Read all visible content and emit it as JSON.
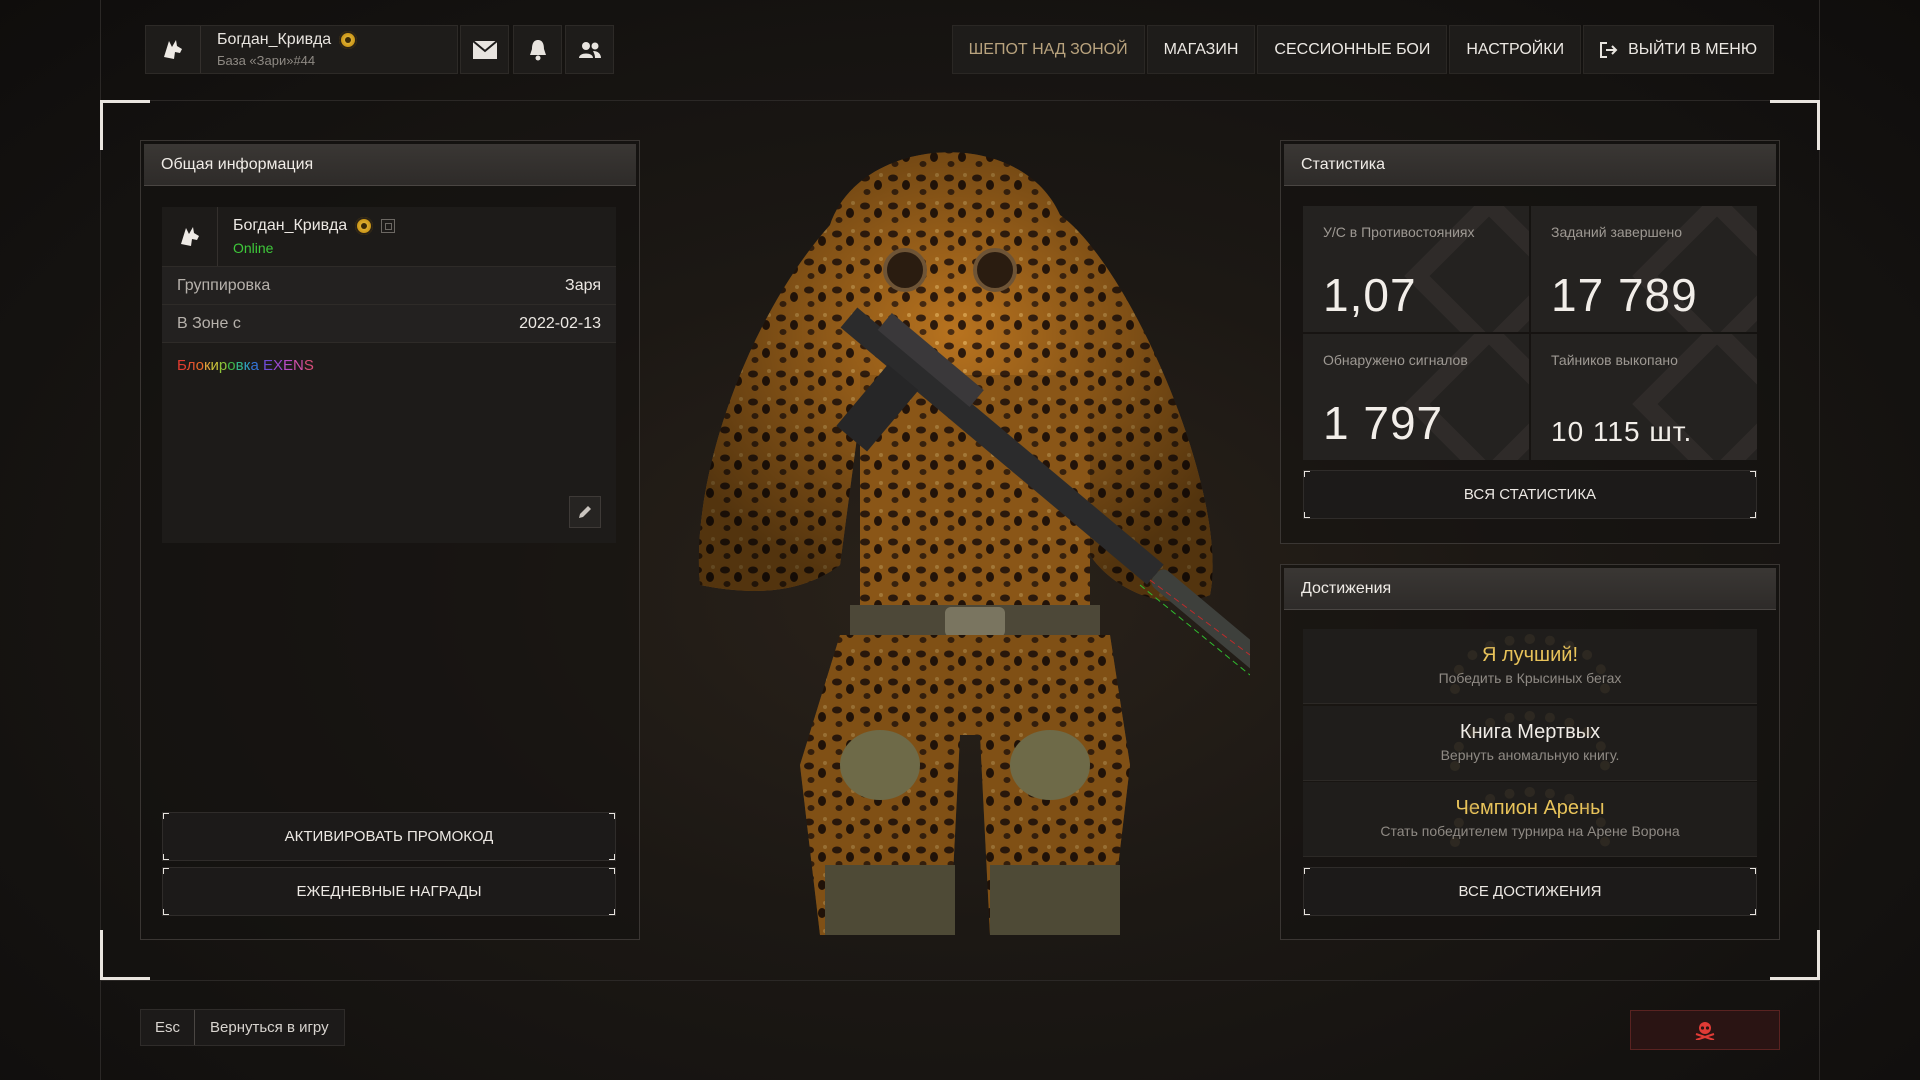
{
  "header": {
    "username": "Богдан_Кривда",
    "base": "База «Зари»#44",
    "nav": [
      {
        "label": "ШЕПОТ НАД ЗОНОЙ",
        "active": true
      },
      {
        "label": "МАГАЗИН"
      },
      {
        "label": "СЕССИОННЫЕ БОИ"
      },
      {
        "label": "НАСТРОЙКИ"
      },
      {
        "label": "ВЫЙТИ В МЕНЮ",
        "icon": "exit-icon"
      }
    ]
  },
  "general": {
    "title": "Общая информация",
    "username": "Богдан_Кривда",
    "status": "Online",
    "rows": [
      {
        "key": "Группировка",
        "value": "Заря"
      },
      {
        "key": "В Зоне с",
        "value": "2022-02-13"
      }
    ],
    "bio": "Блокировка EXENS",
    "promo_label": "АКТИВИРОВАТЬ ПРОМОКОД",
    "daily_label": "ЕЖЕДНЕВНЫЕ НАГРАДЫ"
  },
  "stats": {
    "title": "Статистика",
    "cells": [
      {
        "label": "У/С в Противостояниях",
        "value": "1,07"
      },
      {
        "label": "Заданий завершено",
        "value": "17 789"
      },
      {
        "label": "Обнаружено сигналов",
        "value": "1 797"
      },
      {
        "label": "Тайников выкопано",
        "value": "10 115 шт."
      }
    ],
    "all_label": "ВСЯ СТАТИСТИКА"
  },
  "achievements": {
    "title": "Достижения",
    "items": [
      {
        "title": "Я лучший!",
        "desc": "Победить в Крысиных бегах",
        "color": "#e8c35a"
      },
      {
        "title": "Книга Мертвых",
        "desc": "Вернуть аномальную книгу.",
        "color": "#f0ece7"
      },
      {
        "title": "Чемпион Арены",
        "desc": "Стать победителем турнира на Арене Ворона",
        "color": "#e8c35a"
      }
    ],
    "all_label": "ВСЕ ДОСТИЖЕНИЯ"
  },
  "footer": {
    "esc_key": "Esc",
    "back_label": "Вернуться в игру"
  }
}
